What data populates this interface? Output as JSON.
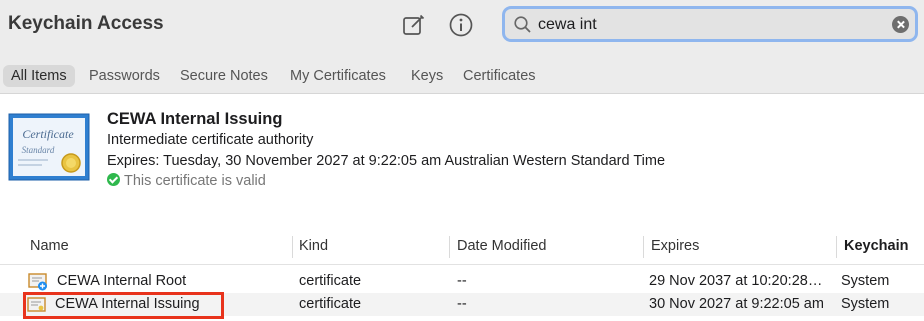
{
  "app": {
    "title": "Keychain Access"
  },
  "toolbar": {
    "compose_icon": "compose-icon",
    "info_icon": "info-icon"
  },
  "search": {
    "value": "cewa int",
    "icon": "search-icon"
  },
  "tabs": [
    {
      "label": "All Items",
      "active": true
    },
    {
      "label": "Passwords"
    },
    {
      "label": "Secure Notes"
    },
    {
      "label": "My Certificates"
    },
    {
      "label": "Keys"
    },
    {
      "label": "Certificates"
    }
  ],
  "detail": {
    "title": "CEWA Internal Issuing",
    "subtitle": "Intermediate certificate authority",
    "expires": "Expires: Tuesday, 30 November 2027 at 9:22:05 am Australian Western Standard Time",
    "status": "This certificate is valid",
    "status_color": "#2fb84d",
    "icon_text_1": "Certificate",
    "icon_text_2": "Standard"
  },
  "table": {
    "columns": [
      "Name",
      "Kind",
      "Date Modified",
      "Expires",
      "Keychain"
    ],
    "rows": [
      {
        "name": "CEWA Internal Root",
        "kind": "certificate",
        "modified": "--",
        "expires": "29 Nov 2037 at 10:20:28…",
        "keychain": "System"
      },
      {
        "name": "CEWA Internal Issuing",
        "kind": "certificate",
        "modified": "--",
        "expires": "30 Nov 2027 at 9:22:05 am",
        "keychain": "System"
      }
    ]
  },
  "colors": {
    "highlight": "#e8331c",
    "search_focus": "#8fb6ee"
  }
}
